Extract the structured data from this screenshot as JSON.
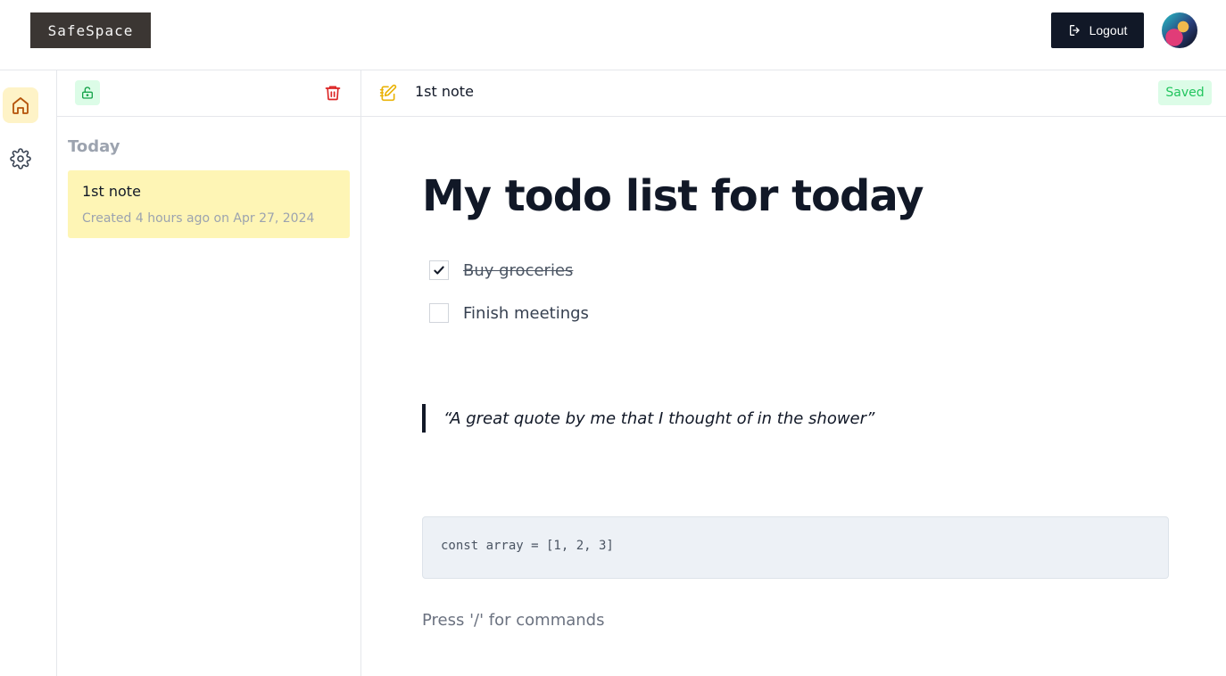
{
  "header": {
    "brand": "SafeSpace",
    "logout_label": "Logout"
  },
  "sidebar": {
    "items": [
      {
        "name": "home",
        "icon": "home-icon",
        "active": true
      },
      {
        "name": "settings",
        "icon": "gear-icon",
        "active": false
      }
    ]
  },
  "notes_panel": {
    "group_label": "Today",
    "notes": [
      {
        "title": "1st note",
        "meta": "Created 4 hours ago on Apr 27, 2024",
        "selected": true
      }
    ]
  },
  "editor": {
    "note_name": "1st note",
    "status": "Saved",
    "title": "My todo list for today",
    "todos": [
      {
        "text": "Buy groceries",
        "checked": true
      },
      {
        "text": "Finish meetings",
        "checked": false
      }
    ],
    "quote": "“A great quote by me that I thought of in the shower”",
    "code": "const array = [1, 2, 3]",
    "placeholder": "Press '/' for commands"
  },
  "colors": {
    "brand_bg": "#3b3633",
    "active_nav_bg": "#fef3c7",
    "selected_note_bg": "#fef5b5",
    "saved_bg": "#dcfce7",
    "saved_text": "#22c55e",
    "danger": "#dc2626"
  }
}
